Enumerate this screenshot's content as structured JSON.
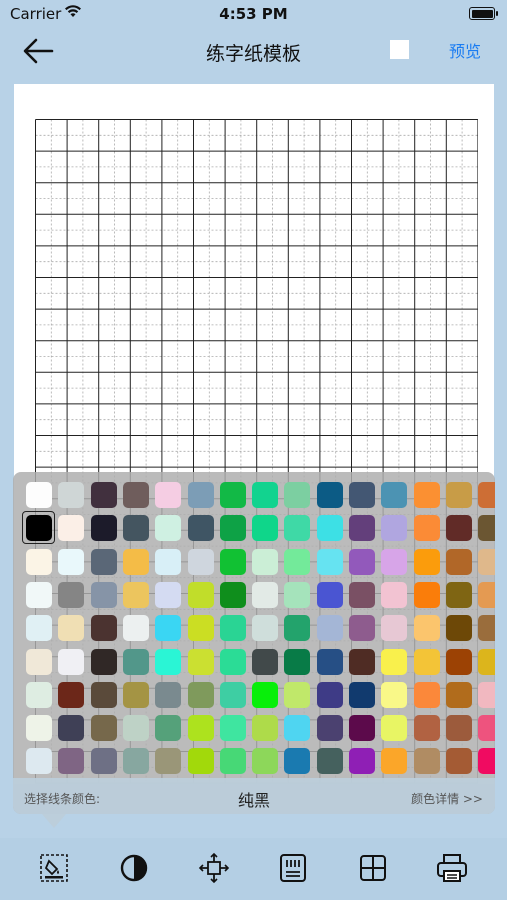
{
  "status_bar": {
    "carrier": "Carrier",
    "time": "4:53 PM"
  },
  "nav": {
    "title": "练字纸模板",
    "preview_label": "预览",
    "checkbox_checked": false
  },
  "palette": {
    "label": "选择线条颜色:",
    "selected_name": "纯黑",
    "detail_link": "颜色详情 >>",
    "rows": [
      [
        "#fdfdfd",
        "#cfd6d6",
        "#41303e",
        "#6f5d5c",
        "#f5cde3",
        "#7c9db6",
        "#12b946",
        "#12d38f",
        "#7ccfa1",
        "#0c5b85",
        "#435773",
        "#4c93b3",
        "#fb9032",
        "#c89c47",
        "#cd6e35"
      ],
      [
        "#000000",
        "#fbefe7",
        "#1c1b2a",
        "#445560",
        "#cff0e2",
        "#3f5564",
        "#0ea246",
        "#0fd68a",
        "#3fd9a6",
        "#3de0e5",
        "#633f7b",
        "#b0a6e0",
        "#fb8b36",
        "#612b27",
        "#6b5632"
      ],
      [
        "#fbf4e6",
        "#e9f8fb",
        "#5a6777",
        "#f4bc47",
        "#d8eff7",
        "#cfd6de",
        "#11c133",
        "#cbeed6",
        "#73ea9a",
        "#66e3f1",
        "#9259bb",
        "#d7a5e8",
        "#fb9c0c",
        "#b16728",
        "#dfb88b"
      ],
      [
        "#f1f8f8",
        "#858585",
        "#8694a7",
        "#ecc55e",
        "#d4dbf2",
        "#c1dd2a",
        "#0f8e1c",
        "#e2eae6",
        "#a5e3bb",
        "#4a55d2",
        "#7a5064",
        "#f2c3d2",
        "#fa7d0a",
        "#7f6513",
        "#e49a52"
      ],
      [
        "#e0f0f4",
        "#f0dfb4",
        "#4b3330",
        "#ecf0f0",
        "#3ad6f3",
        "#cbde23",
        "#2ad494",
        "#cfdedb",
        "#23a36c",
        "#a4b6d6",
        "#8e5c8e",
        "#e7c8d4",
        "#fbc56d",
        "#6d4807",
        "#9a6d3c"
      ],
      [
        "#f0e8d8",
        "#f0f0f4",
        "#302826",
        "#52978a",
        "#2af5d5",
        "#cbe031",
        "#2bdc96",
        "#41494a",
        "#087b47",
        "#264f85",
        "#4f2c24",
        "#f9f04c",
        "#f3c437",
        "#9c4204",
        "#dcb51c"
      ],
      [
        "#deede2",
        "#6c2719",
        "#5a4a3a",
        "#a49444",
        "#7a8a8f",
        "#7f9a5c",
        "#3ecea3",
        "#08ef0a",
        "#c0e86a",
        "#3e3b86",
        "#113a6e",
        "#f9f888",
        "#fb883a",
        "#b16c1c",
        "#f1b8c0"
      ],
      [
        "#eef3e8",
        "#3f4056",
        "#76684b",
        "#bed2c6",
        "#55a17a",
        "#ade21e",
        "#3fe5a0",
        "#aedb4a",
        "#4fd5f1",
        "#4b4170",
        "#5c0a4b",
        "#e8f564",
        "#b16242",
        "#9c5b3c",
        "#ee537e"
      ],
      [
        "#dde9f0",
        "#7f6584",
        "#6e7085",
        "#87a7a0",
        "#9a9678",
        "#a2d90b",
        "#47d876",
        "#8dd75a",
        "#1a7ab0",
        "#45615e",
        "#8f1fb5",
        "#fba629",
        "#b08c63",
        "#a45b34",
        "#f00b61"
      ]
    ]
  },
  "toolbar": {
    "items": [
      "color-fill",
      "contrast",
      "resize",
      "template",
      "grid",
      "print"
    ]
  }
}
